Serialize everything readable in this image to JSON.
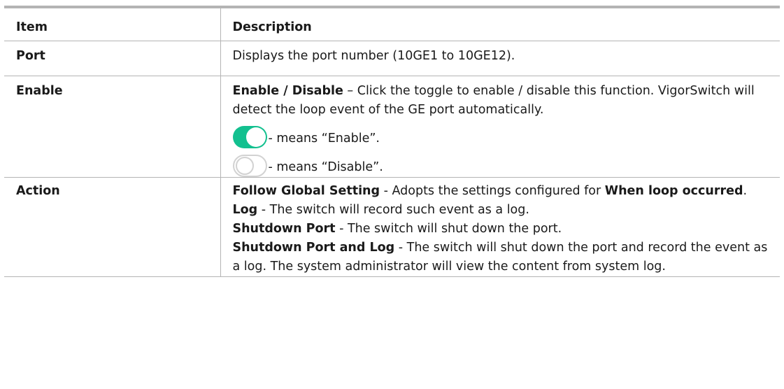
{
  "table": {
    "headers": {
      "item": "Item",
      "description": "Description"
    },
    "rows": {
      "port": {
        "item": "Port",
        "text": "Displays the port number (10GE1 to 10GE12)."
      },
      "enable": {
        "item": "Enable",
        "lead_bold": "Enable / Disable",
        "lead_rest": " – Click the toggle to enable / disable this function. VigorSwitch will detect the loop event of the GE port automatically.",
        "on_text": " - means “Enable”.",
        "off_text": " - means “Disable”."
      },
      "action": {
        "item": "Action",
        "follow_bold": "Follow Global Setting",
        "follow_rest": " - Adopts the settings configured for ",
        "follow_ref": "When loop occurred",
        "follow_end": ".",
        "log_bold": "Log",
        "log_rest": " - The switch will record such event as a log.",
        "shutdown_bold": "Shutdown Port",
        "shutdown_rest": " - The switch will shut down the port.",
        "shutdown_log_bold": "Shutdown Port and Log",
        "shutdown_log_rest": " - The switch will shut down the port and record the event as a log. The system administrator will view the content from system log."
      }
    }
  },
  "colors": {
    "toggle_on": "#13c08f",
    "toggle_off_border": "#d2d2d2",
    "rule": "#b4b4b4"
  },
  "icons": {
    "on": "toggle-on-icon",
    "off": "toggle-off-icon"
  }
}
